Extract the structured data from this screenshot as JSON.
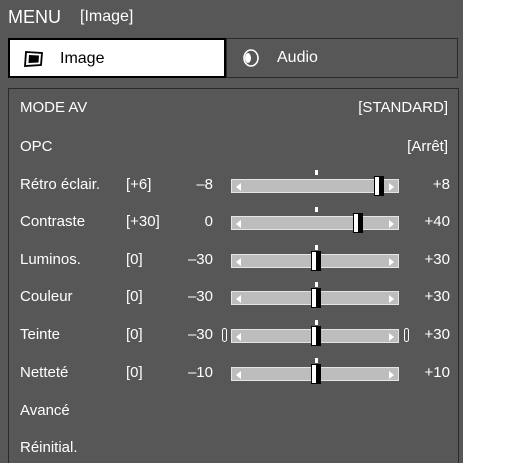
{
  "header": {
    "menu_label": "MENU",
    "crumb": "[Image]"
  },
  "tabs": [
    {
      "label": "Image",
      "icon": "tv-icon",
      "selected": true
    },
    {
      "label": "Audio",
      "icon": "speaker-icon",
      "selected": false
    }
  ],
  "items": [
    {
      "label": "MODE AV",
      "value": "[STANDARD]"
    },
    {
      "label": "OPC",
      "value": "[Arrêt]"
    }
  ],
  "sliders": [
    {
      "label": "Rétro éclair.",
      "setting": "[+6]",
      "min": "–8",
      "max": "+8",
      "level": 0.875
    },
    {
      "label": "Contraste",
      "setting": "[+30]",
      "min": "0",
      "max": "+40",
      "level": 0.75
    },
    {
      "label": "Luminos.",
      "setting": "[0]",
      "min": "–30",
      "max": "+30",
      "level": 0.5
    },
    {
      "label": "Couleur",
      "setting": "[0]",
      "min": "–30",
      "max": "+30",
      "level": 0.5
    },
    {
      "label": "Teinte",
      "setting": "[0]",
      "min": "–30",
      "max": "+30",
      "level": 0.5
    },
    {
      "label": "Netteté",
      "setting": "[0]",
      "min": "–10",
      "max": "+10",
      "level": 0.5
    }
  ],
  "bottom_items": [
    {
      "label": "Avancé"
    },
    {
      "label": "Réinitial."
    }
  ]
}
